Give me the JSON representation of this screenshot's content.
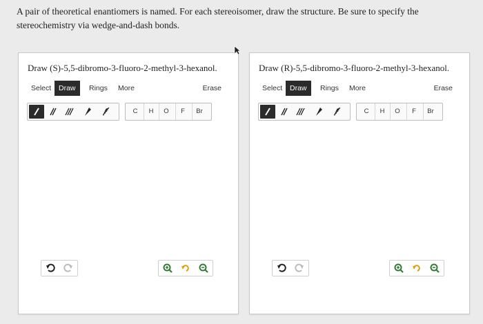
{
  "question": {
    "text": "A pair of theoretical enantiomers is named. For each stereoisomer, draw the structure. Be sure to specify the stereochemistry via wedge-and-dash bonds."
  },
  "panels": [
    {
      "title": "Draw (S)-5,5-dibromo-3-fluoro-2-methyl-3-hexanol.",
      "tabs": [
        "Select",
        "Draw",
        "Rings",
        "More"
      ],
      "active_tab": "Draw",
      "erase_label": "Erase",
      "atoms": [
        "C",
        "H",
        "O",
        "F",
        "Br"
      ]
    },
    {
      "title": "Draw (R)-5,5-dibromo-3-fluoro-2-methyl-3-hexanol.",
      "tabs": [
        "Select",
        "Draw",
        "Rings",
        "More"
      ],
      "active_tab": "Draw",
      "erase_label": "Erase",
      "atoms": [
        "C",
        "H",
        "O",
        "F",
        "Br"
      ]
    }
  ],
  "icons": {
    "bond_tools": [
      "single-bond-icon",
      "double-bond-icon",
      "triple-bond-icon",
      "wedge-bond-icon",
      "dash-bond-icon"
    ],
    "history": [
      "undo-icon",
      "redo-icon"
    ],
    "zoom": [
      "zoom-in-icon",
      "zoom-reset-icon",
      "zoom-out-icon"
    ]
  },
  "colors": {
    "active_dark": "#2b2b2b",
    "icon_green": "#2e7d32",
    "icon_orange": "#e0a010"
  }
}
